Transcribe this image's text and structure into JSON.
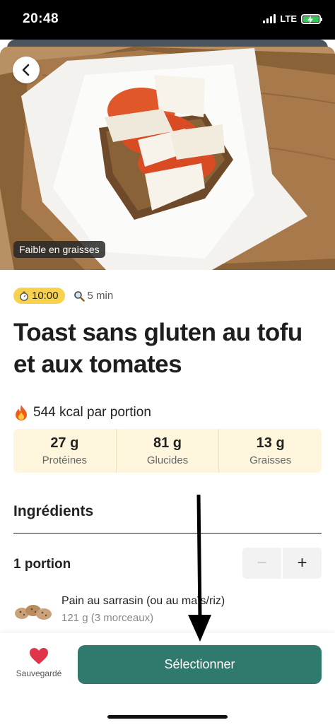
{
  "status_bar": {
    "time": "20:48",
    "network": "LTE",
    "battery_color": "#34c759"
  },
  "hero": {
    "image_description_icon": "tofu-tomato-toast-photo",
    "badge": "Faible en graisses",
    "back_icon": "chevron-left-icon"
  },
  "meta": {
    "cook_time": "10:00",
    "prep_time": "5 min"
  },
  "recipe": {
    "title": "Toast sans gluten au tofu et aux tomates",
    "kcal": "544 kcal par portion"
  },
  "macros": [
    {
      "value": "27 g",
      "label": "Protéines"
    },
    {
      "value": "81 g",
      "label": "Glucides"
    },
    {
      "value": "13 g",
      "label": "Graisses"
    }
  ],
  "ingredients": {
    "heading": "Ingrédients",
    "portion": "1 portion",
    "minus": "−",
    "plus": "+",
    "items": [
      {
        "name": "Pain au sarrasin (ou au maïs/riz)",
        "quantity": "121 g (3 morceaux)"
      }
    ]
  },
  "bottom": {
    "saved_label": "Sauvegardé",
    "select_label": "Sélectionner"
  },
  "colors": {
    "accent": "#2f7a6c",
    "badge_yellow": "#f7d24c",
    "macros_bg": "#fdf6dd",
    "heart": "#e0344b"
  }
}
